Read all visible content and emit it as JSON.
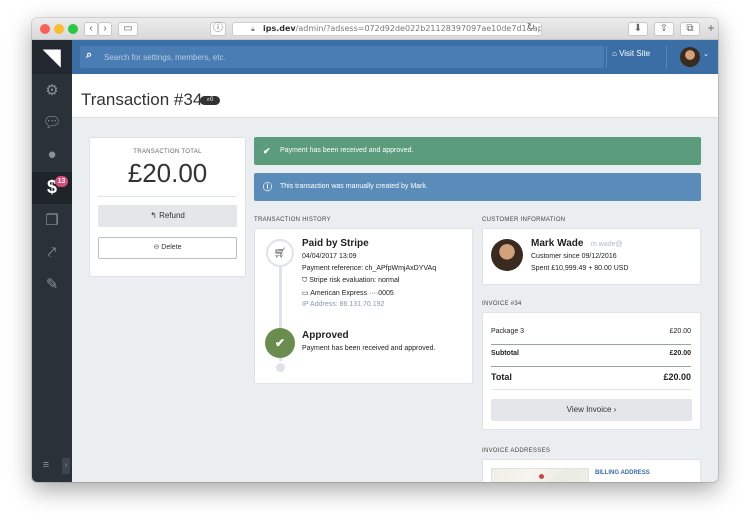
{
  "browser": {
    "url": "ips.dev/admin/?adsess=072d92de022b21128397097ae10de7d1&app=nex",
    "domain": "ips.dev",
    "path": "/admin/?adsess=072d92de022b21128397097ae10de7d1&app=nex"
  },
  "topbar": {
    "search_placeholder": "Search for settings, members, etc.",
    "visit_site": "Visit Site"
  },
  "sidebar": {
    "badge": "13"
  },
  "page": {
    "title": "Transaction #34",
    "title_badge": "0"
  },
  "total_card": {
    "label": "TRANSACTION TOTAL",
    "amount": "£20.00",
    "refund": "Refund",
    "delete": "Delete"
  },
  "alerts": {
    "success": "Payment has been received and approved.",
    "info": "This transaction was manually created by Mark."
  },
  "history": {
    "heading": "TRANSACTION HISTORY",
    "paid_title": "Paid by Stripe",
    "paid_date": "04/04/2017 13:09",
    "payment_ref": "Payment reference: ch_APfpWmjAxDYVAq",
    "risk": "Stripe risk evaluation: normal",
    "card": "American Express ····0005",
    "ip": "IP Address: 86.131.70.192",
    "approved_title": "Approved",
    "approved_desc": "Payment has been received and approved."
  },
  "customer": {
    "heading": "CUSTOMER INFORMATION",
    "name": "Mark Wade",
    "email": "m.wade@",
    "since": "Customer since 09/12/2016",
    "spent": "Spent £10,999.49 + 80.00 USD"
  },
  "invoice": {
    "heading": "INVOICE #34",
    "item_name": "Package 3",
    "item_price": "£20.00",
    "subtotal_label": "Subtotal",
    "subtotal_value": "£20.00",
    "total_label": "Total",
    "total_value": "£20.00",
    "view_button": "View Invoice"
  },
  "addresses": {
    "heading": "INVOICE ADDRESSES",
    "billing_label": "BILLING ADDRESS"
  },
  "colors": {
    "topbar": "#3a6ea5",
    "success": "#5b9c7d",
    "info": "#5a8cba",
    "approved_icon": "#6a8c4e",
    "badge": "#d74b74"
  }
}
